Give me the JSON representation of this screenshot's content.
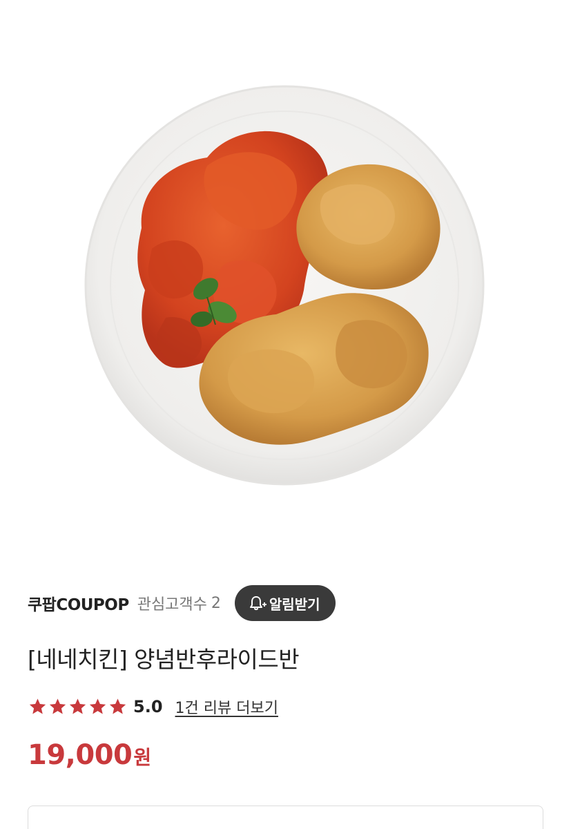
{
  "product_image": {
    "icon": "fried-chicken-plate-image",
    "plate_color": "#f2f1ef",
    "sauce_color": "#d94a24",
    "fried_color": "#d9a04e",
    "garnish_color": "#3f7a2e"
  },
  "store": {
    "name": "쿠팝COUPOP",
    "follower_label": "관심고객수",
    "follower_count": "2",
    "notify_button_label": "알림받기",
    "notify_icon": "bell-plus-icon"
  },
  "product": {
    "title": "[네네치킨] 양념반후라이드반",
    "rating": {
      "stars": 5,
      "max_stars": 5,
      "value": "5.0",
      "review_link": "1건 리뷰 더보기",
      "star_color": "#c8393c"
    },
    "price": {
      "amount": "19,000",
      "unit": "원",
      "color": "#c8393c"
    }
  }
}
